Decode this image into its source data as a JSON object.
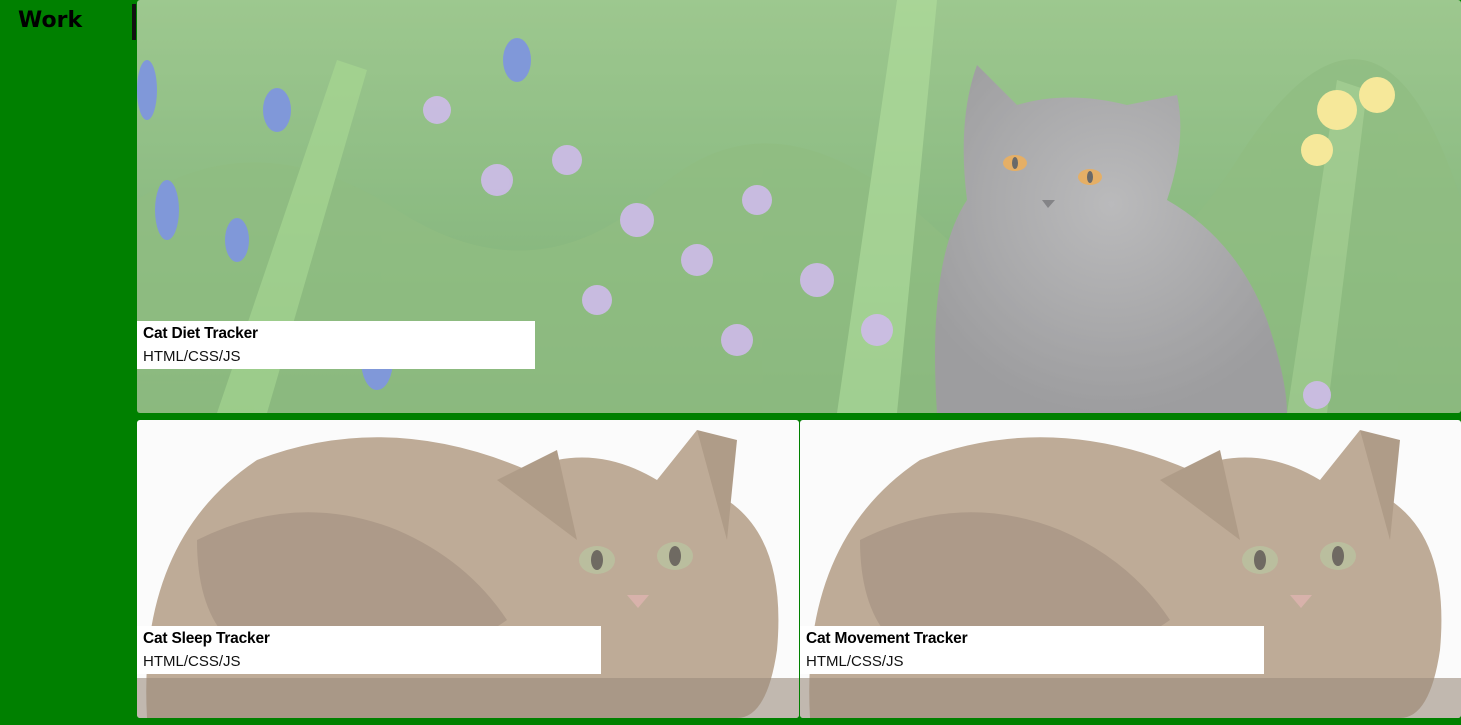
{
  "sidebar": {
    "title": "Work"
  },
  "colors": {
    "background": "#008000",
    "caption_bg": "#ffffff",
    "text": "#000000"
  },
  "projects": [
    {
      "title": "Cat Diet Tracker",
      "tech": "HTML/CSS/JS",
      "image": "grey-cat-in-flowers"
    },
    {
      "title": "Cat Sleep Tracker",
      "tech": "HTML/CSS/JS",
      "image": "tabby-kitten"
    },
    {
      "title": "Cat Movement Tracker",
      "tech": "HTML/CSS/JS",
      "image": "tabby-kitten"
    }
  ]
}
